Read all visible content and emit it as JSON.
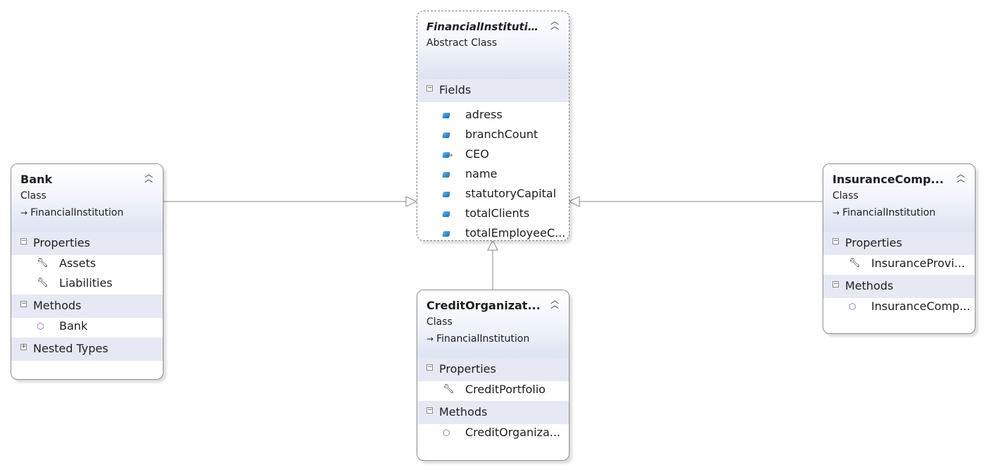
{
  "classes": {
    "financial": {
      "name": "FinancialInstitution",
      "kind": "Abstract Class",
      "compartments": [
        {
          "label": "Fields",
          "expanded": true,
          "members": [
            "adress",
            "branchCount",
            "CEO",
            "name",
            "statutoryCapital",
            "totalClients",
            "totalEmployeeC..."
          ]
        }
      ]
    },
    "bank": {
      "name": "Bank",
      "kind": "Class",
      "base": "FinancialInstitution",
      "compartments": [
        {
          "label": "Properties",
          "expanded": true,
          "members": [
            "Assets",
            "Liabilities"
          ]
        },
        {
          "label": "Methods",
          "expanded": true,
          "members": [
            "Bank"
          ]
        },
        {
          "label": "Nested Types",
          "expanded": false,
          "members": []
        }
      ]
    },
    "insurance": {
      "name": "InsuranceComp...",
      "kind": "Class",
      "base": "FinancialInstitution",
      "compartments": [
        {
          "label": "Properties",
          "expanded": true,
          "members": [
            "InsuranceProvi..."
          ]
        },
        {
          "label": "Methods",
          "expanded": true,
          "members": [
            "InsuranceComp..."
          ]
        }
      ]
    },
    "credit": {
      "name": "CreditOrganizat...",
      "kind": "Class",
      "base": "FinancialInstitution",
      "compartments": [
        {
          "label": "Properties",
          "expanded": true,
          "members": [
            "CreditPortfolio"
          ]
        },
        {
          "label": "Methods",
          "expanded": true,
          "members": [
            "CreditOrganiza..."
          ]
        }
      ]
    }
  },
  "colors": {
    "line": "#8a8a8a",
    "compartment": "#e6e9f3",
    "field_icon": "#1b6fb0",
    "method_icon": "#8a4fc7"
  },
  "icons": {
    "collapse": "double-chevron-up-icon",
    "inherits": "arrow-right-icon",
    "field": "field-icon",
    "static_field": "static-field-icon",
    "property": "wrench-icon",
    "method": "method-cube-icon",
    "expanded": "minus-box-icon",
    "collapsed": "plus-box-icon"
  }
}
